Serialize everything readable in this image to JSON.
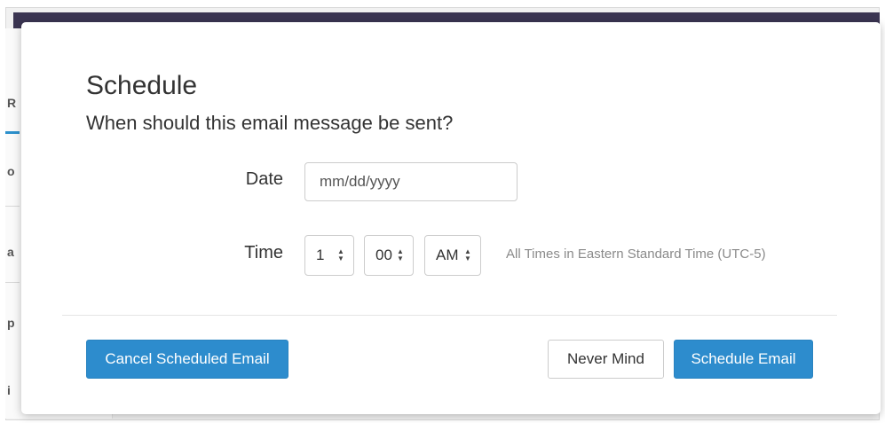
{
  "background": {
    "glyphs": [
      "R",
      "o",
      "a",
      "p",
      "i"
    ]
  },
  "dialog": {
    "title": "Schedule",
    "subtitle": "When should this email message be sent?",
    "date": {
      "label": "Date",
      "placeholder": "mm/dd/yyyy"
    },
    "time": {
      "label": "Time",
      "hour": "1",
      "minute": "00",
      "period": "AM",
      "timezone_note": "All Times in Eastern Standard Time (UTC-5)"
    },
    "buttons": {
      "cancel_scheduled": "Cancel Scheduled Email",
      "never_mind": "Never Mind",
      "schedule": "Schedule Email"
    }
  },
  "colors": {
    "primary": "#2d8ccd",
    "topbar": "#3b3552",
    "text": "#333333",
    "muted": "#8a8a8a"
  }
}
